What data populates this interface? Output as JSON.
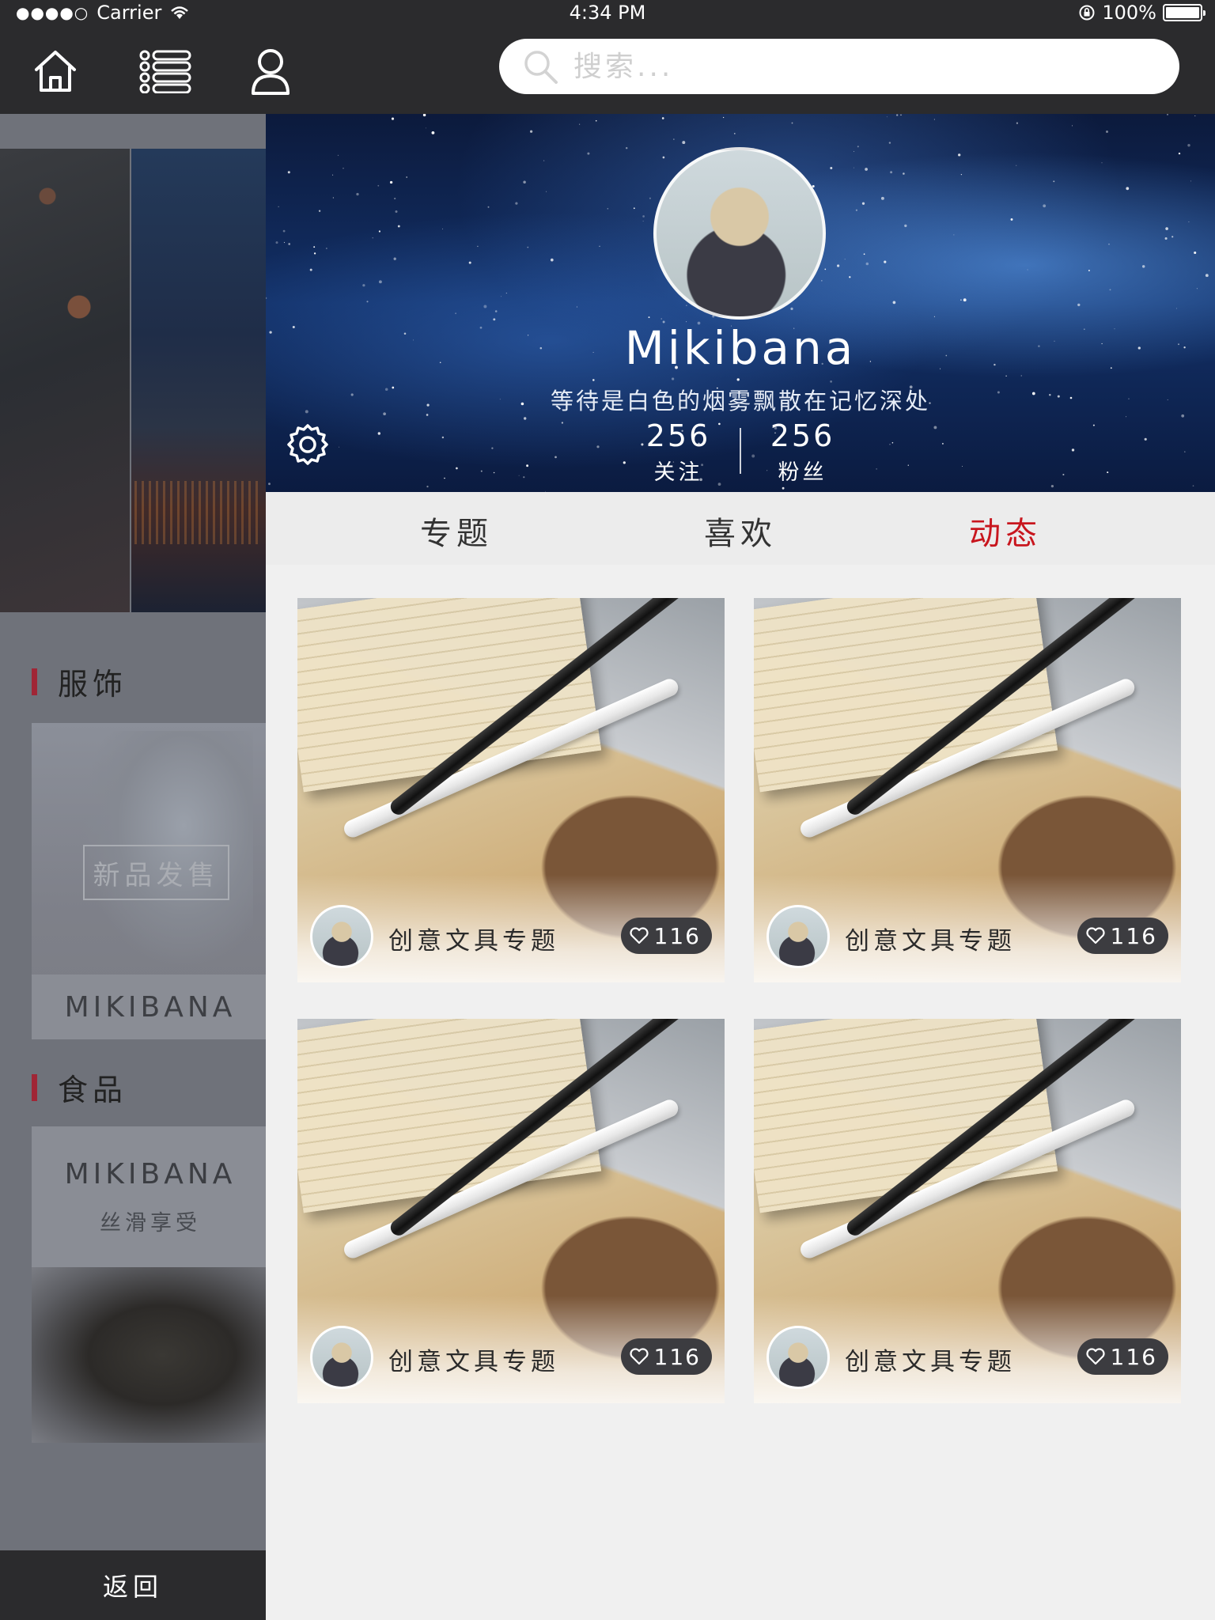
{
  "status_bar": {
    "carrier": "Carrier",
    "time": "4:34 PM",
    "battery": "100%"
  },
  "nav": {
    "search_placeholder": "搜索..."
  },
  "drawer": {
    "categories": [
      {
        "label": "服饰",
        "tag": "新品发售",
        "brand": "MIKIBANA"
      },
      {
        "label": "食品",
        "brand": "MIKIBANA",
        "subtitle": "丝滑享受"
      }
    ],
    "back_label": "返回"
  },
  "profile": {
    "name": "Mikibana",
    "bio": "等待是白色的烟雾飘散在记忆深处",
    "following_count": "256",
    "following_label": "关注",
    "followers_count": "256",
    "followers_label": "粉丝"
  },
  "tabs": [
    {
      "label": "专题",
      "active": false
    },
    {
      "label": "喜欢",
      "active": false
    },
    {
      "label": "动态",
      "active": true
    }
  ],
  "cards": [
    {
      "title": "创意文具专题",
      "likes": "116"
    },
    {
      "title": "创意文具专题",
      "likes": "116"
    },
    {
      "title": "创意文具专题",
      "likes": "116"
    },
    {
      "title": "创意文具专题",
      "likes": "116"
    }
  ],
  "colors": {
    "accent": "#c8161e",
    "nav_bg": "#2b2b2d",
    "category_bar": "#a02636"
  }
}
